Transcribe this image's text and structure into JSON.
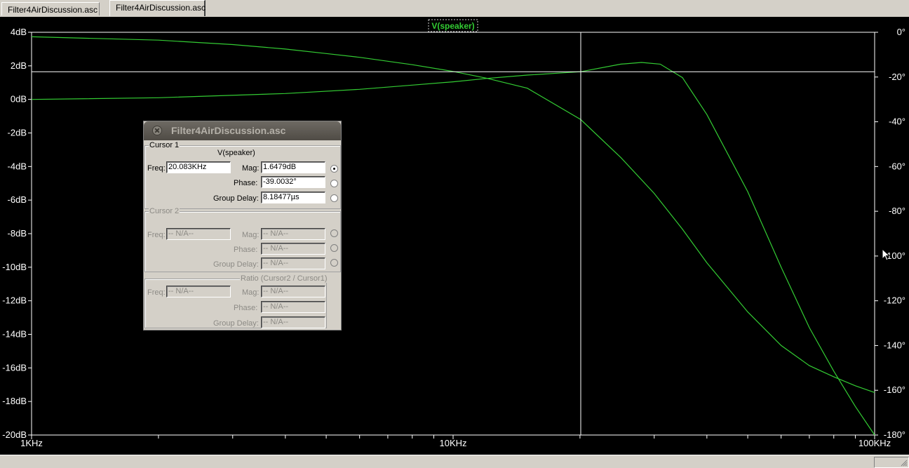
{
  "tabs": [
    {
      "label": "Filter4AirDiscussion.asc",
      "active": false
    },
    {
      "label": "Filter4AirDiscussion.asc",
      "active": true
    }
  ],
  "chart_data": {
    "type": "line",
    "title": "V(speaker)",
    "x_scale": "log",
    "xlim": [
      1000,
      100000
    ],
    "x_tick_labels": [
      "1KHz",
      "10KHz",
      "100KHz"
    ],
    "y_left": {
      "unit": "dB",
      "ylim": [
        -20,
        4
      ],
      "tick_labels": [
        "4dB",
        "2dB",
        "0dB",
        "-2dB",
        "-4dB",
        "-6dB",
        "-8dB",
        "-10dB",
        "-12dB",
        "-14dB",
        "-16dB",
        "-18dB",
        "-20dB"
      ]
    },
    "y_right": {
      "unit": "deg",
      "ylim": [
        -180,
        0
      ],
      "tick_labels": [
        "0°",
        "-20°",
        "-40°",
        "-60°",
        "-80°",
        "-100°",
        "-120°",
        "-140°",
        "-160°",
        "-180°"
      ]
    },
    "grid": false,
    "colors": {
      "trace": "#33cc33",
      "axis": "#ffffff",
      "background": "#000000",
      "cursor": "#ffffff"
    },
    "series": [
      {
        "name": "V(speaker)",
        "kind": "magnitude",
        "axis": "left",
        "x": [
          1000,
          2000,
          4000,
          6000,
          8000,
          10000,
          12000,
          15000,
          20083,
          25000,
          28000,
          31000,
          35000,
          40000,
          50000,
          60000,
          70000,
          80000,
          90000,
          100000
        ],
        "y": [
          0.0,
          0.1,
          0.35,
          0.6,
          0.85,
          1.05,
          1.25,
          1.45,
          1.65,
          2.1,
          2.2,
          2.1,
          1.3,
          -0.9,
          -5.5,
          -10.0,
          -13.6,
          -16.2,
          -18.3,
          -20.0
        ]
      },
      {
        "name": "V(speaker)",
        "kind": "phase",
        "axis": "right",
        "x": [
          1000,
          2000,
          3000,
          4000,
          5000,
          6000,
          8000,
          10000,
          12000,
          15000,
          20083,
          25000,
          30000,
          35000,
          40000,
          50000,
          60000,
          70000,
          80000,
          90000,
          100000
        ],
        "y": [
          -2,
          -3.5,
          -5.5,
          -7.5,
          -9.5,
          -11.2,
          -14.5,
          -17.5,
          -20.5,
          -25,
          -39.0,
          -56,
          -72,
          -88,
          -103,
          -125,
          -140,
          -149,
          -154,
          -158,
          -161
        ]
      }
    ],
    "cursor": {
      "x": 20083,
      "y": 1.6479
    }
  },
  "cursor_dialog": {
    "title": "Filter4AirDiscussion.asc",
    "cursor1": {
      "group_label": "Cursor 1",
      "trace": "V(speaker)",
      "freq_label": "Freq:",
      "freq": "20.083KHz",
      "mag_label": "Mag:",
      "mag": "1.6479dB",
      "phase_label": "Phase:",
      "phase": "-39.0032°",
      "gd_label": "Group Delay:",
      "gd": "8.18477µs",
      "selected": "mag"
    },
    "cursor2": {
      "group_label": "Cursor 2",
      "freq_label": "Freq:",
      "freq": "-- N/A--",
      "mag_label": "Mag:",
      "mag": "-- N/A--",
      "phase_label": "Phase:",
      "phase": "-- N/A--",
      "gd_label": "Group Delay:",
      "gd": "-- N/A--"
    },
    "ratio": {
      "group_label": "Ratio (Cursor2 / Cursor1)",
      "freq_label": "Freq:",
      "freq": "-- N/A--",
      "mag_label": "Mag:",
      "mag": "-- N/A--",
      "phase_label": "Phase:",
      "phase": "-- N/A--",
      "gd_label": "Group Delay:",
      "gd": "-- N/A--"
    }
  }
}
